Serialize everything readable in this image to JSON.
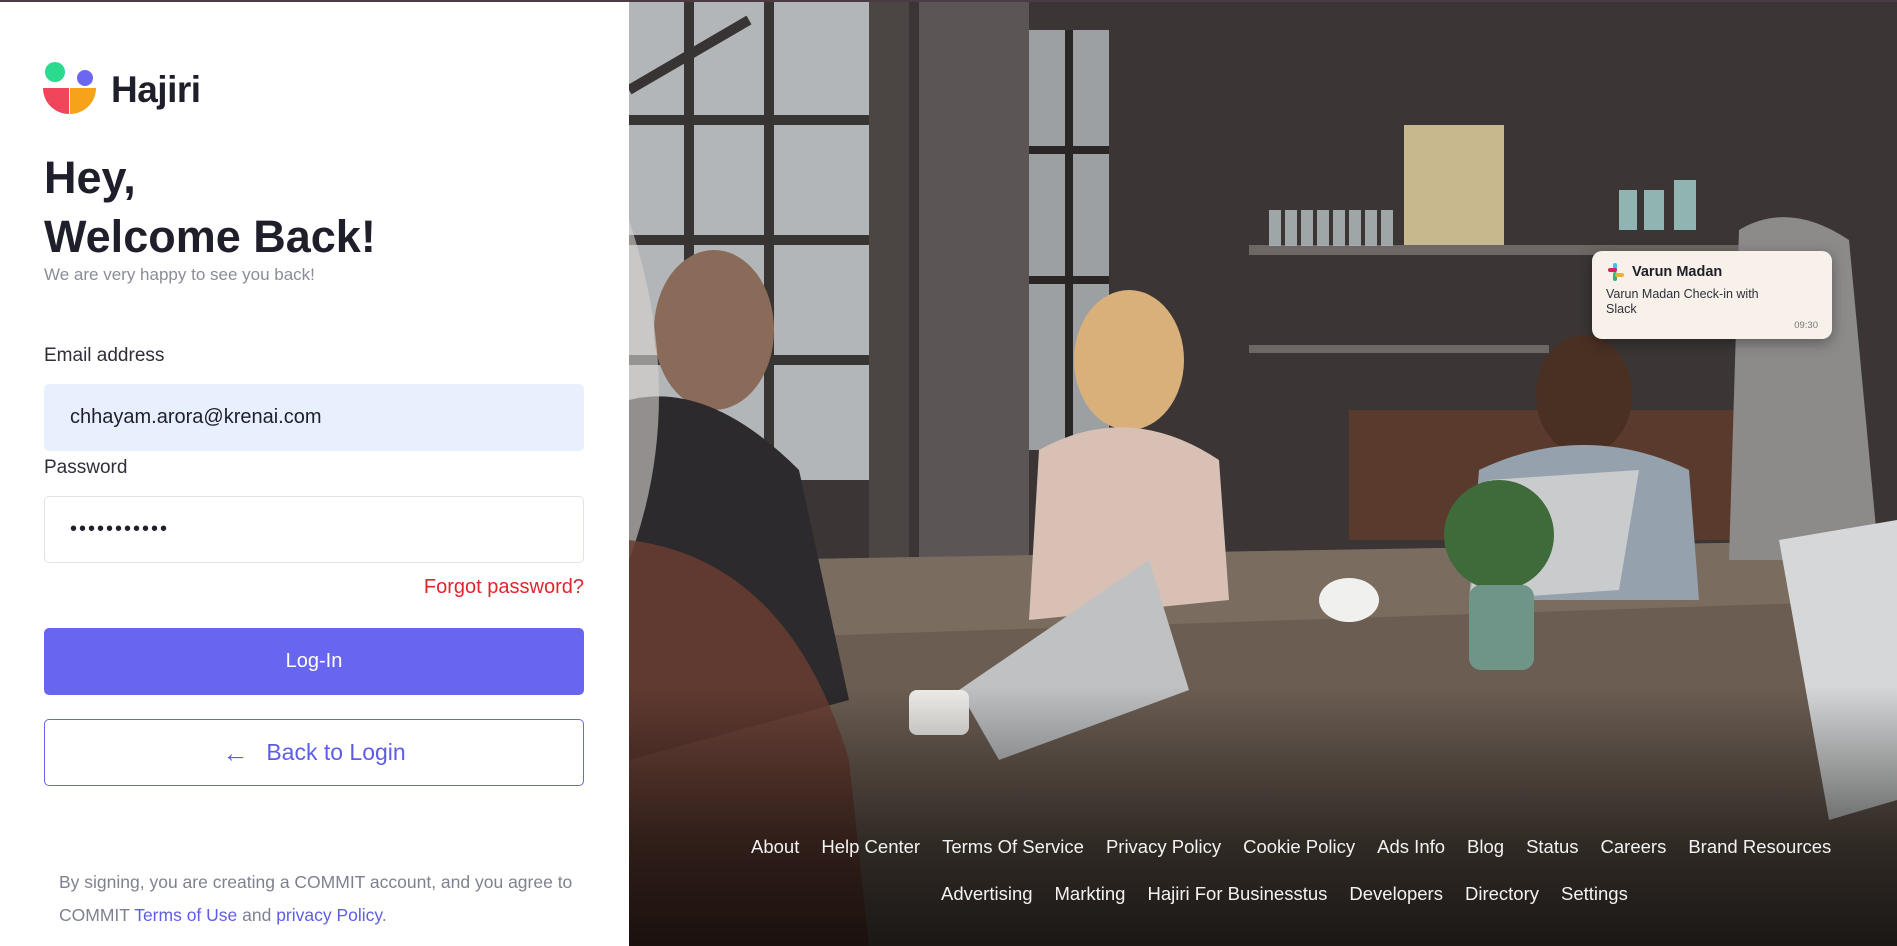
{
  "brand": {
    "name": "Hajiri"
  },
  "greeting": {
    "line1": "Hey,",
    "line2": "Welcome Back!",
    "subtitle": "We are very happy to see you back!"
  },
  "form": {
    "email_label": "Email address",
    "email_value": "chhayam.arora@krenai.com",
    "password_label": "Password",
    "password_value": "•••••••••••",
    "forgot_label": "Forgot password?",
    "login_button": "Log-In",
    "back_button": "Back to Login",
    "back_icon": "arrow-left-icon"
  },
  "terms": {
    "prefix": "By signing, you are creating a COMMIT account, and you agree to COMMIT ",
    "terms_link": "Terms of Use",
    "middle": " and ",
    "privacy_link": "privacy Policy",
    "suffix": "."
  },
  "notification": {
    "icon": "slack-icon",
    "sender": "Varun Madan",
    "message": "Varun Madan Check-in with Slack",
    "time": "09:30"
  },
  "footer": {
    "row1": [
      "About",
      "Help Center",
      "Terms Of Service",
      "Privacy Policy",
      "Cookie Policy",
      "Ads Info",
      "Blog",
      "Status",
      "Careers",
      "Brand Resources"
    ],
    "row2": [
      "Advertising",
      "Markting",
      "Hajiri For Businesstus",
      "Developers",
      "Directory",
      "Settings"
    ]
  },
  "colors": {
    "accent": "#6866f0",
    "forgot": "#e0262b",
    "email_bg": "#e8f0fe"
  }
}
